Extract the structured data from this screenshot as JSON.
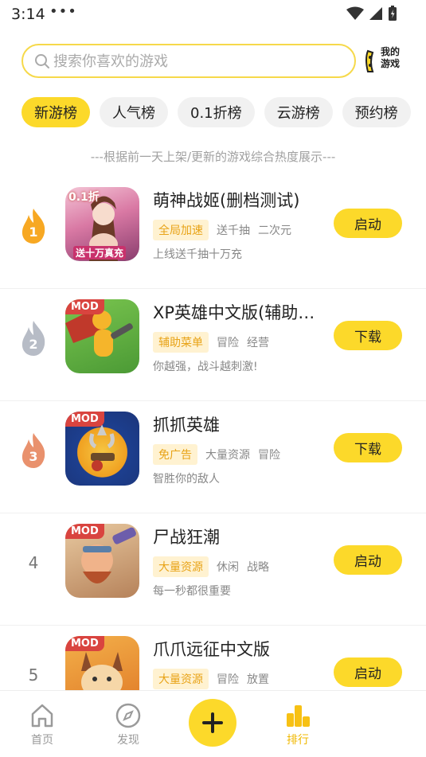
{
  "status_bar": {
    "time": "3:14",
    "dots": "•••"
  },
  "search": {
    "placeholder": "搜索你喜欢的游戏",
    "value": ""
  },
  "my_games": {
    "label": "我的游戏"
  },
  "chips": [
    {
      "label": "新游榜",
      "active": true
    },
    {
      "label": "人气榜"
    },
    {
      "label": "0.1折榜"
    },
    {
      "label": "云游榜"
    },
    {
      "label": "预约榜"
    }
  ],
  "subtitle": "---根据前一天上架/更新的游戏综合热度展示---",
  "games": [
    {
      "rank": "1",
      "title": "萌神战姬(删档测试)",
      "highlight_tag": "全局加速",
      "tags": [
        "送千抽",
        "二次元"
      ],
      "desc": "上线送千抽十万充",
      "action": "启动",
      "mod": "",
      "icon_overlay_top": "0.1折",
      "icon_overlay_bottom": "送十万真充"
    },
    {
      "rank": "2",
      "title": "XP英雄中文版(辅助菜单)",
      "highlight_tag": "辅助菜单",
      "tags": [
        "冒险",
        "经营"
      ],
      "desc": "你越强，战斗越刺激!",
      "action": "下载",
      "mod": "MOD"
    },
    {
      "rank": "3",
      "title": "抓抓英雄",
      "highlight_tag": "免广告",
      "tags": [
        "大量资源",
        "冒险"
      ],
      "desc": "智胜你的敌人",
      "action": "下载",
      "mod": "MOD"
    },
    {
      "rank": "4",
      "title": "尸战狂潮",
      "highlight_tag": "大量资源",
      "tags": [
        "休闲",
        "战略"
      ],
      "desc": "每一秒都很重要",
      "action": "启动",
      "mod": "MOD"
    },
    {
      "rank": "5",
      "title": "爪爪远征中文版",
      "highlight_tag": "大量资源",
      "tags": [
        "冒险",
        "放置"
      ],
      "desc": "",
      "action": "启动",
      "mod": "MOD"
    }
  ],
  "nav": {
    "home": "首页",
    "discover": "发现",
    "rank": "排行"
  },
  "colors": {
    "accent": "#fcd92a",
    "tag_bg": "#fff2d1",
    "tag_text": "#e8a317",
    "rank1": "#f7a823",
    "rank2": "#b7bcc6",
    "rank3": "#e9916d"
  }
}
